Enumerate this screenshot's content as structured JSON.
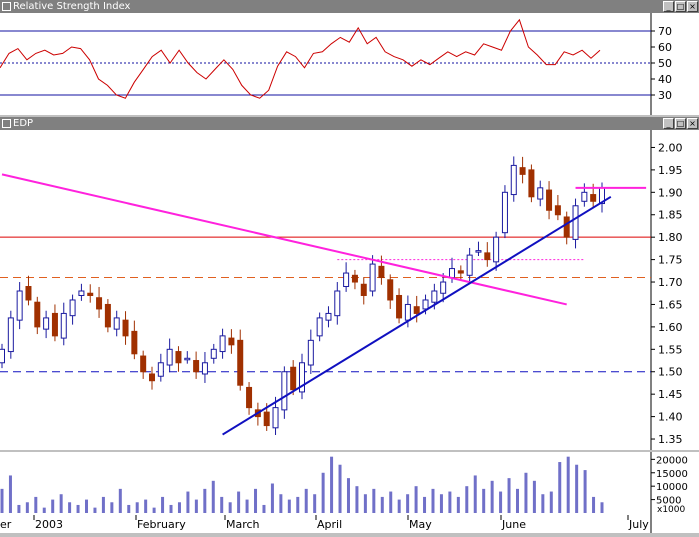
{
  "rsi_pane": {
    "title": "Relative Strength Index",
    "ticks": [
      "70",
      "60",
      "50",
      "40",
      "30"
    ]
  },
  "price_pane": {
    "title": "EDP",
    "ticks": [
      "2.00",
      "1.95",
      "1.90",
      "1.85",
      "1.80",
      "1.75",
      "1.70",
      "1.65",
      "1.60",
      "1.55",
      "1.50",
      "1.45",
      "1.40",
      "1.35"
    ]
  },
  "volume_pane": {
    "ticks": [
      "20000",
      "15000",
      "10000",
      "5000"
    ],
    "multiplier": "x1000"
  },
  "x_labels": [
    "er",
    "2003",
    "February",
    "March",
    "April",
    "May",
    "June",
    "July"
  ],
  "colors": {
    "rsi_line": "#cc0000",
    "up": "#1a1aa0",
    "down": "#a03000",
    "volume": "#7070c8",
    "magenta": "#ff22dd",
    "trend": "#1010c0",
    "red_line": "#dd0000",
    "orange": "#e06020",
    "blue_dash": "#1010c0"
  },
  "chart_data": [
    {
      "type": "line",
      "title": "Relative Strength Index",
      "ylim": [
        20,
        80
      ],
      "reference_lines": [
        70,
        50,
        30
      ],
      "series": [
        {
          "values": [
            47,
            56,
            59,
            52,
            56,
            58,
            55,
            56,
            60,
            59,
            52,
            40,
            36,
            30,
            28,
            38,
            46,
            54,
            58,
            50,
            58,
            50,
            44,
            40,
            46,
            52,
            46,
            36,
            30,
            28,
            33,
            48,
            57,
            54,
            47,
            56,
            57,
            62,
            66,
            63,
            72,
            62,
            66,
            57,
            54,
            52,
            48,
            52,
            49,
            53,
            57,
            54,
            57,
            55,
            62,
            60,
            58,
            70,
            77,
            60,
            55,
            49,
            49,
            57,
            55,
            58,
            53,
            58
          ]
        }
      ]
    },
    {
      "type": "candlestick",
      "title": "EDP",
      "ylim": [
        1.33,
        2.03
      ],
      "x_tick_labels": [
        "er",
        "2003",
        "February",
        "March",
        "April",
        "May",
        "June",
        "July"
      ],
      "closes": [
        1.55,
        1.62,
        1.68,
        1.66,
        1.6,
        1.62,
        1.58,
        1.63,
        1.66,
        1.68,
        1.67,
        1.64,
        1.6,
        1.62,
        1.58,
        1.54,
        1.5,
        1.48,
        1.52,
        1.55,
        1.52,
        1.53,
        1.5,
        1.52,
        1.55,
        1.58,
        1.56,
        1.47,
        1.42,
        1.4,
        1.38,
        1.42,
        1.5,
        1.46,
        1.52,
        1.57,
        1.62,
        1.63,
        1.68,
        1.72,
        1.7,
        1.67,
        1.74,
        1.71,
        1.66,
        1.62,
        1.65,
        1.63,
        1.66,
        1.68,
        1.7,
        1.73,
        1.72,
        1.76,
        1.77,
        1.75,
        1.8,
        1.9,
        1.96,
        1.94,
        1.89,
        1.91,
        1.86,
        1.85,
        1.8,
        1.87,
        1.9,
        1.88,
        1.91
      ],
      "reference_lines": {
        "red": 1.8,
        "orange_dash": 1.71,
        "blue_dash": 1.5
      },
      "trend_lines": [
        {
          "color": "magenta",
          "from": [
            0,
            1.94
          ],
          "to": [
            64,
            1.65
          ]
        },
        {
          "color": "blue",
          "from": [
            25,
            1.36
          ],
          "to": [
            69,
            1.89
          ]
        },
        {
          "color": "magenta",
          "from": [
            65,
            1.91
          ],
          "to": [
            73,
            1.91
          ]
        }
      ],
      "dotted_magenta_level": 1.75
    },
    {
      "type": "bar",
      "title": "",
      "ylabel": "x1000",
      "ylim": [
        0,
        22000
      ],
      "values": [
        9000,
        14000,
        3000,
        4000,
        6000,
        2000,
        5000,
        7000,
        4000,
        3000,
        5000,
        2000,
        6000,
        4000,
        9000,
        3000,
        4000,
        5000,
        2000,
        6000,
        3000,
        4000,
        8000,
        5000,
        9000,
        12000,
        6000,
        4000,
        8000,
        5000,
        9000,
        3000,
        11000,
        7000,
        5000,
        6000,
        9000,
        7000,
        15000,
        21000,
        18000,
        13000,
        10000,
        7000,
        9000,
        6000,
        8000,
        5000,
        7000,
        10000,
        6000,
        9000,
        7000,
        8000,
        6000,
        10000,
        14000,
        9000,
        12000,
        8000,
        13000,
        9000,
        15000,
        12000,
        7000,
        8000,
        19000,
        21000,
        18000,
        16000,
        6000,
        4000
      ]
    }
  ]
}
